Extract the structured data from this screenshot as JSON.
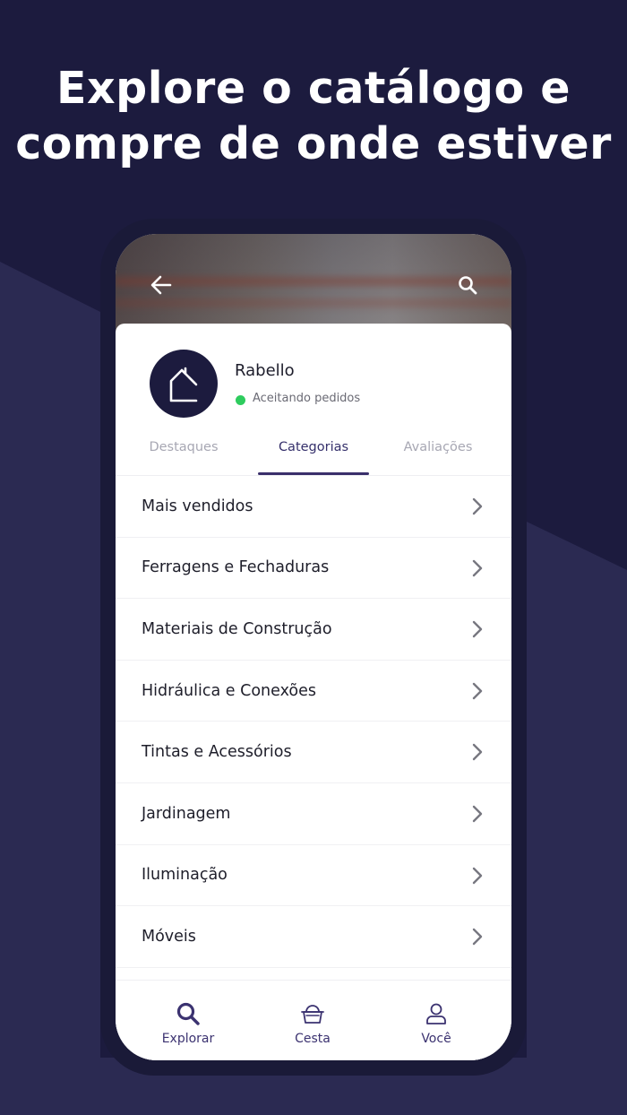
{
  "headline": {
    "line1": "Explore o catálogo e",
    "line2": "compre de onde estiver"
  },
  "colors": {
    "background": "#1c1b3e",
    "background_shape": "#2b2a52",
    "accent": "#3a2f6b",
    "status_green": "#2ecc5e"
  },
  "header": {
    "back_icon": "arrow-left-icon",
    "search_icon": "search-icon"
  },
  "store": {
    "name": "Rabello",
    "status": "Aceitando pedidos",
    "logo_icon": "house-icon"
  },
  "tabs": [
    {
      "label": "Destaques",
      "active": false
    },
    {
      "label": "Categorias",
      "active": true
    },
    {
      "label": "Avaliações",
      "active": false
    }
  ],
  "categories": [
    {
      "label": "Mais vendidos"
    },
    {
      "label": "Ferragens e Fechaduras"
    },
    {
      "label": "Materiais de Construção"
    },
    {
      "label": "Hidráulica e Conexões"
    },
    {
      "label": "Tintas e Acessórios"
    },
    {
      "label": "Jardinagem"
    },
    {
      "label": "Iluminação"
    },
    {
      "label": "Móveis"
    }
  ],
  "bottom_nav": [
    {
      "label": "Explorar",
      "icon": "search-icon"
    },
    {
      "label": "Cesta",
      "icon": "basket-icon"
    },
    {
      "label": "Você",
      "icon": "user-icon"
    }
  ]
}
